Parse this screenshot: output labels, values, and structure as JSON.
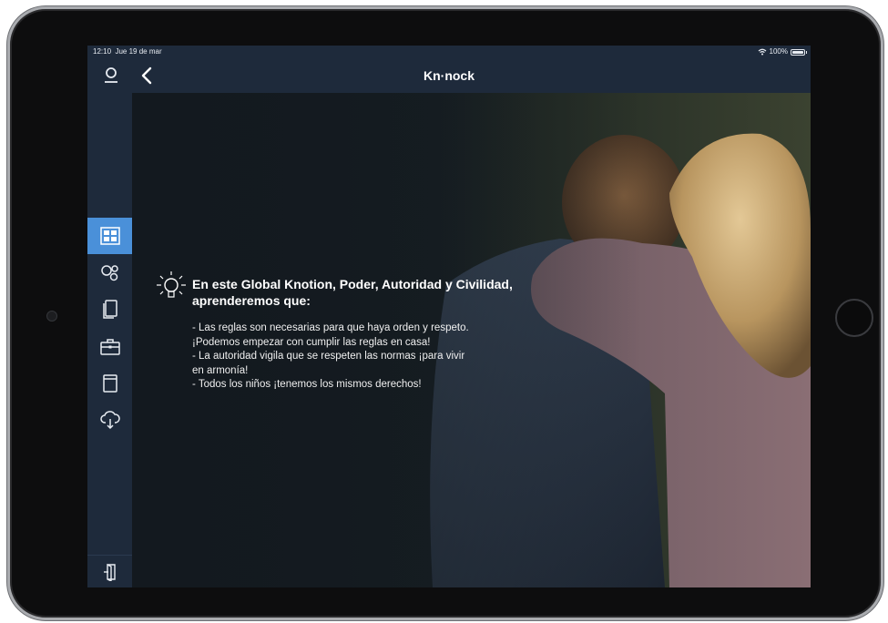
{
  "status_bar": {
    "time": "12:10",
    "date": "Jue 19 de mar",
    "battery_text": "100%",
    "icons": [
      "wifi-icon",
      "battery-icon"
    ]
  },
  "navbar": {
    "title": "Kn·nock",
    "icons": [
      "user-icon",
      "back-chevron-icon"
    ]
  },
  "sidebar": {
    "items": [
      {
        "name": "dashboard",
        "icon": "grid-layout-icon",
        "active": true
      },
      {
        "name": "circles",
        "icon": "circles-icon",
        "active": false
      },
      {
        "name": "books",
        "icon": "books-icon",
        "active": false
      },
      {
        "name": "briefcase",
        "icon": "briefcase-icon",
        "active": false
      },
      {
        "name": "archive",
        "icon": "archive-box-icon",
        "active": false
      },
      {
        "name": "cloud-download",
        "icon": "cloud-download-icon",
        "active": false
      }
    ],
    "bottom_icon": "logout-door-icon"
  },
  "content": {
    "bulb_icon": "lightbulb-icon",
    "heading": "En este Global Knotion, Poder, Autoridad y Civilidad, aprenderemos que:",
    "bullets": [
      "- Las reglas son necesarias para que haya orden y respeto.",
      "¡Podemos empezar con cumplir las reglas en casa!",
      "- La autoridad vigila que se respeten las normas ¡para vivir",
      "en armonía!",
      "- Todos los niños ¡tenemos los mismos derechos!"
    ]
  },
  "colors": {
    "nav_bg": "#1e2a3b",
    "active_item": "#4a90d9",
    "text": "#ffffff"
  }
}
